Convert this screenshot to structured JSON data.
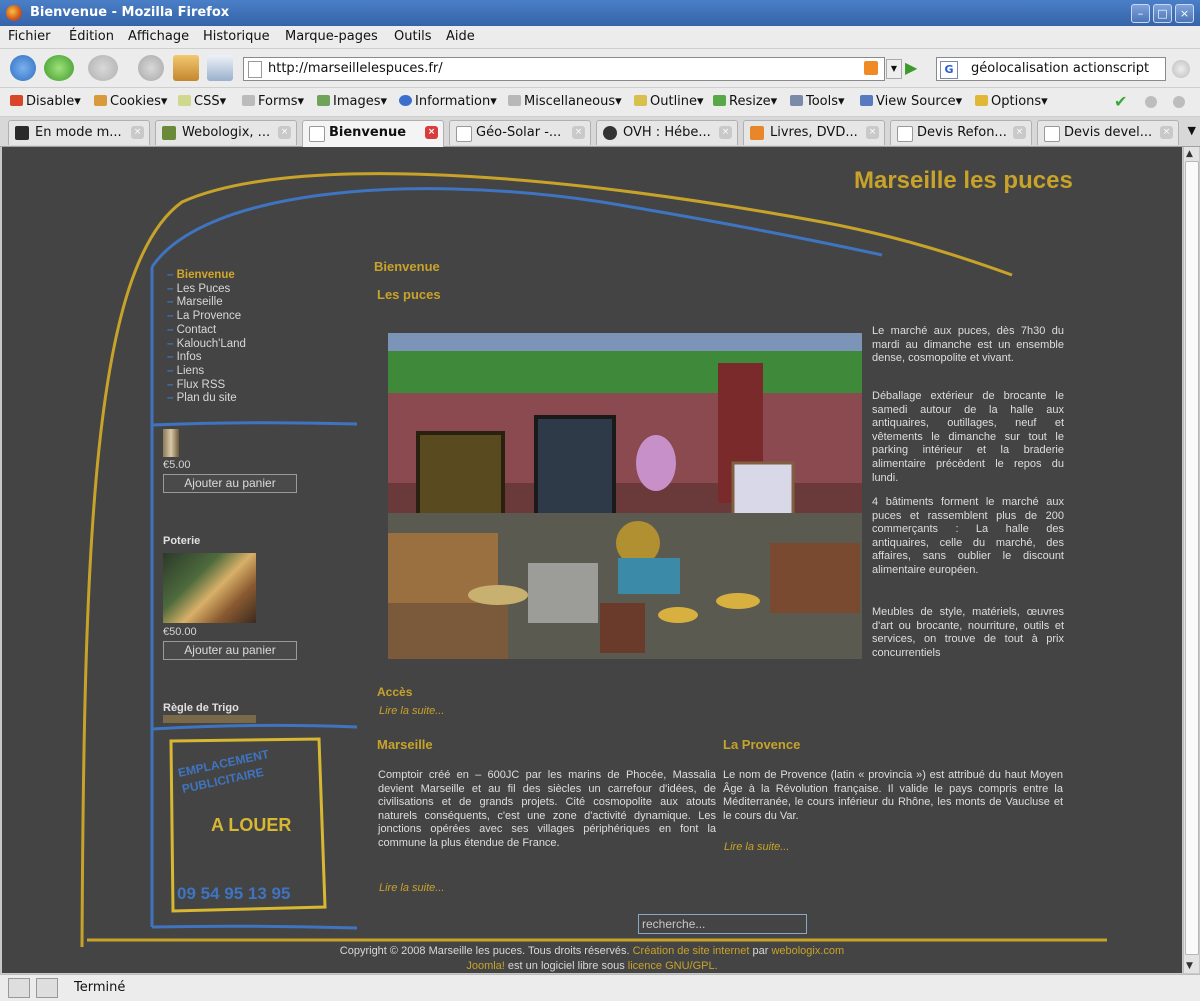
{
  "window": {
    "title": "Bienvenue - Mozilla Firefox"
  },
  "menu": [
    "Fichier",
    "Édition",
    "Affichage",
    "Historique",
    "Marque-pages",
    "Outils",
    "Aide"
  ],
  "navbar": {
    "url": "http://marseillelespuces.fr/",
    "search_query": "géolocalisation actionscript"
  },
  "webdev_toolbar": [
    "Disable",
    "Cookies",
    "CSS",
    "Forms",
    "Images",
    "Information",
    "Miscellaneous",
    "Outline",
    "Resize",
    "Tools",
    "View Source",
    "Options"
  ],
  "tabs": [
    {
      "label": "En mode m...",
      "active": false
    },
    {
      "label": "Webologix, ...",
      "active": false
    },
    {
      "label": "Bienvenue",
      "active": true
    },
    {
      "label": "Géo-Solar -...",
      "active": false
    },
    {
      "label": "OVH : Hébe...",
      "active": false
    },
    {
      "label": "Livres, DVD...",
      "active": false
    },
    {
      "label": "Devis Refon...",
      "active": false
    },
    {
      "label": "Devis devel...",
      "active": false
    }
  ],
  "status": {
    "text": "Terminé"
  },
  "site": {
    "title": "Marseille les puces",
    "nav": [
      "Bienvenue",
      "Les Puces",
      "Marseille",
      "La Provence",
      "Contact",
      "Kalouch'Land",
      "Infos",
      "Liens",
      "Flux RSS",
      "Plan du site"
    ],
    "products": [
      {
        "name": "",
        "price": "€5.00",
        "button": "Ajouter au panier"
      },
      {
        "name": "Poterie",
        "price": "€50.00",
        "button": "Ajouter au panier"
      },
      {
        "name": "Règle de Trigo",
        "price": "",
        "button": ""
      }
    ],
    "ad": {
      "line1": "EMPLACEMENT",
      "line2": "PUBLICITAIRE",
      "cta": "A LOUER",
      "phone": "09 54 95 13 95"
    },
    "main": {
      "welcome_heading": "Bienvenue",
      "puces_heading": "Les puces",
      "paragraphs": [
        "Le marché aux puces, dès 7h30 du mardi au dimanche est un ensemble dense, cosmopolite et vivant.",
        "Déballage extérieur de brocante le samedi autour de la halle aux antiquaires, outillages, neuf et vêtements le dimanche sur tout le parking intérieur et la braderie alimentaire précèdent le repos du lundi.",
        "4 bâtiments forment le marché aux puces et rassemblent plus de 200 commerçants : La halle des antiquaires, celle du marché, des affaires, sans oublier le discount alimentaire européen.",
        "Meubles de style, matériels, œuvres d'art ou brocante, nourriture, outils et services, on trouve de tout à prix concurrentiels"
      ],
      "acces_heading": "Accès",
      "read_more": "Lire la suite...",
      "marseille_heading": "Marseille",
      "marseille_text": "Comptoir créé en – 600JC par les marins de Phocée, Massalia devient Marseille et au fil des siècles un carrefour d'idées, de civilisations et de grands projets. Cité cosmopolite aux atouts naturels conséquents, c'est une zone d'activité dynamique. Les jonctions opérées avec ses villages périphériques en font la commune la plus étendue de France.",
      "provence_heading": "La Provence",
      "provence_text": "Le nom de Provence (latin « provincia ») est attribué du haut Moyen Âge à la Révolution française. Il valide le pays compris entre la Méditerranée, le cours inférieur du Rhône, les monts de Vaucluse et le cours du Var."
    },
    "search_placeholder": "recherche...",
    "footer": {
      "copyright": "Copyright © 2008 Marseille les puces. Tous droits réservés.",
      "creation_link": "Création de site internet",
      "by": "par",
      "agency_link": "webologix.com",
      "joomla_link": "Joomla!",
      "joomla_text": "est un logiciel libre sous",
      "license_link": "licence GNU/GPL."
    }
  },
  "colors": {
    "page_bg": "#444444",
    "accent_gold": "#c8a32a",
    "accent_blue": "#3f74c0"
  }
}
